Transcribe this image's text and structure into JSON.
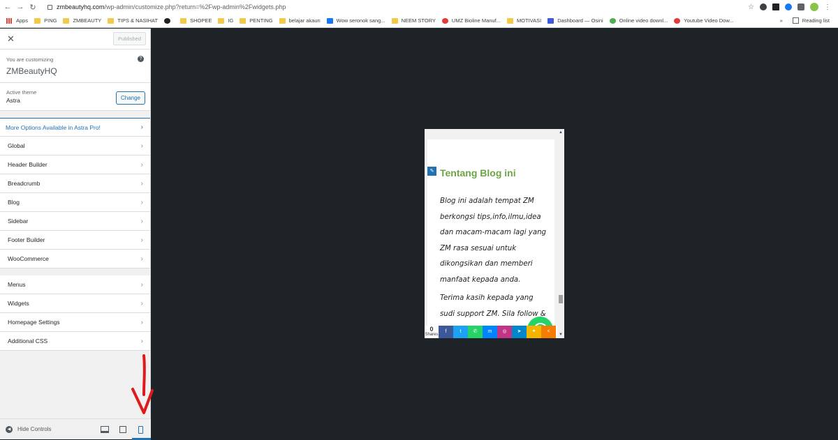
{
  "browser": {
    "url_domain": "zmbeautyhq.com",
    "url_path": "/wp-admin/customize.php?return=%2Fwp-admin%2Fwidgets.php",
    "bookmarks": [
      {
        "label": "Apps",
        "icon": "apps-grid-icon"
      },
      {
        "label": "PING",
        "icon": "folder-icon"
      },
      {
        "label": "ZMBEAUTY",
        "icon": "folder-icon"
      },
      {
        "label": "TIPS & NASIHAT",
        "icon": "folder-icon"
      },
      {
        "label": "",
        "icon": "globe-icon"
      },
      {
        "label": "SHOPEE",
        "icon": "folder-icon"
      },
      {
        "label": "IG",
        "icon": "folder-icon"
      },
      {
        "label": "PENTING",
        "icon": "folder-icon"
      },
      {
        "label": "belajar akaun",
        "icon": "folder-icon"
      },
      {
        "label": "Wow seronok sang...",
        "icon": "facebook-icon"
      },
      {
        "label": "NEEM STORY",
        "icon": "folder-icon"
      },
      {
        "label": "UMZ Bioline Manuf...",
        "icon": "site-icon"
      },
      {
        "label": "MOTIVASI",
        "icon": "folder-icon"
      },
      {
        "label": "Dashboard — Osini",
        "icon": "dashboard-icon"
      },
      {
        "label": "Online video downl...",
        "icon": "download-icon"
      },
      {
        "label": "Youtube Video Dow...",
        "icon": "youtube-icon"
      }
    ],
    "more": "»",
    "reading_list": "Reading list"
  },
  "customizer": {
    "close": "✕",
    "published": "Published",
    "customizing_label": "You are customizing",
    "site_name": "ZMBeautyHQ",
    "help": "?",
    "active_theme_label": "Active theme",
    "active_theme": "Astra",
    "change": "Change",
    "pro_item": "More Options Available in Astra Pro!",
    "sections": [
      "Global",
      "Header Builder",
      "Breadcrumb",
      "Blog",
      "Sidebar",
      "Footer Builder",
      "WooCommerce"
    ],
    "sections2": [
      "Menus",
      "Widgets",
      "Homepage Settings",
      "Additional CSS"
    ],
    "hide_controls": "Hide Controls"
  },
  "preview": {
    "widget_title": "Tentang Blog ini",
    "para1": "Blog ini adalah tempat ZM berkongsi tips,info,ilmu,idea dan macam-macam lagi yang ZM rasa sesuai untuk dikongsikan dan memberi manfaat kepada anda.",
    "para2": "Terima kasih kepada yang sudi support ZM. Sila follow & tinggalkan jejak anda ur",
    "share_count": "0",
    "share_label": "Shares",
    "share_buttons": [
      {
        "icon": "facebook-icon",
        "glyph": "f",
        "color": "#3b5998"
      },
      {
        "icon": "twitter-icon",
        "glyph": "t",
        "color": "#1da1f2"
      },
      {
        "icon": "whatsapp-icon",
        "glyph": "✆",
        "color": "#25d366"
      },
      {
        "icon": "messenger-icon",
        "glyph": "m",
        "color": "#0084ff"
      },
      {
        "icon": "instagram-icon",
        "glyph": "◎",
        "color": "#c13584"
      },
      {
        "icon": "telegram-icon",
        "glyph": "➤",
        "color": "#0088cc"
      },
      {
        "icon": "copy-link-icon",
        "glyph": "⚭",
        "color": "#f4b400"
      },
      {
        "icon": "more-share-icon",
        "glyph": "<",
        "color": "#f57c00"
      }
    ]
  }
}
